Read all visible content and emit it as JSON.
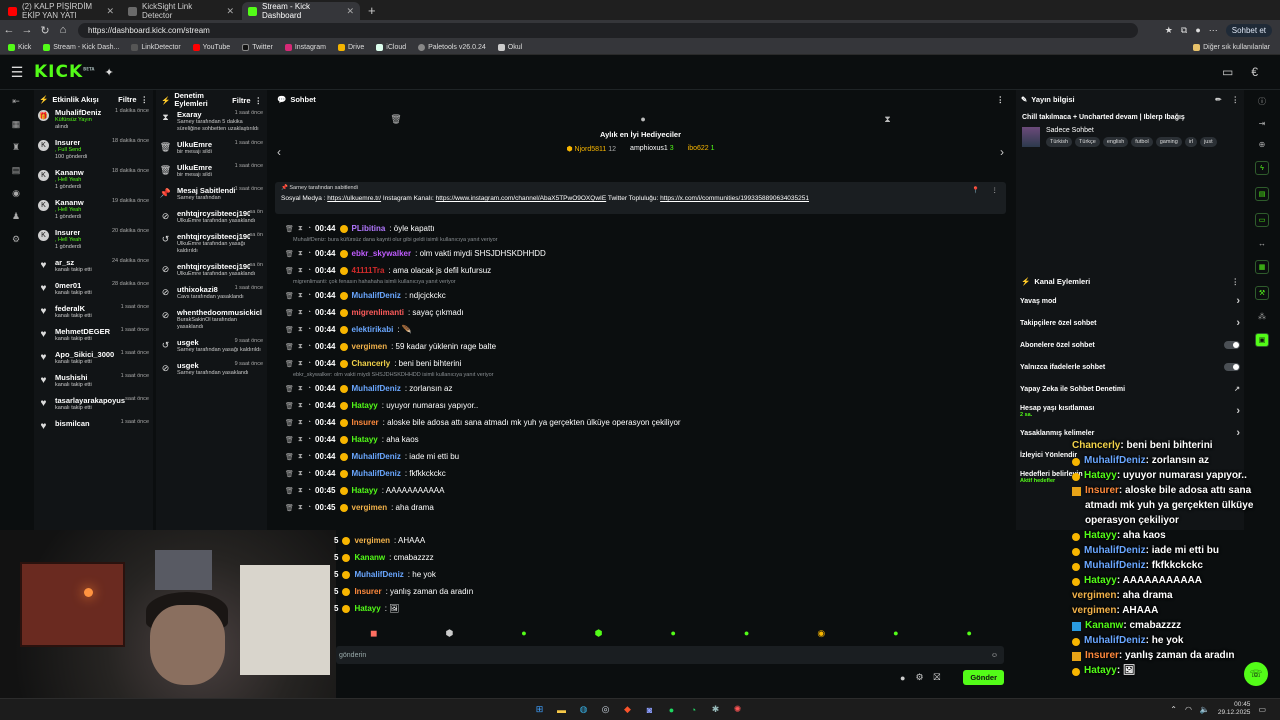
{
  "browser": {
    "tabs": [
      {
        "title": "(2) KALP PİŞİRDİM EKİP YAN YATI",
        "icon": "youtube-icon",
        "color": "#ff0000"
      },
      {
        "title": "KickSight Link Detector",
        "icon": "kicksight-icon",
        "color": "#4a4a4a"
      },
      {
        "title": "Stream - Kick Dashboard",
        "icon": "kick-icon",
        "color": "#53fc18"
      }
    ],
    "url": "https://dashboard.kick.com/stream",
    "profile_button": "Sohbet et",
    "bookmarks": [
      "Kick",
      "Stream - Kick Dash...",
      "LinkDetector",
      "YouTube",
      "Twitter",
      "Instagram",
      "Drive",
      "iCloud",
      "Paletools v26.0.24",
      "Okul"
    ],
    "other_bookmarks": "Diğer sık kullanılanlar"
  },
  "kick": {
    "logo": "KICK",
    "logo_sup": "BETA"
  },
  "activity": {
    "title": "Etkinlik Akışı",
    "filter": "Filtre",
    "items": [
      {
        "name": "MuhalifDeniz",
        "time": "1 dakika önce",
        "line1": "Küfürsüz Yayın",
        "line2": "alındı",
        "icon": "gift-icon"
      },
      {
        "name": "Insurer",
        "time": "18 dakika önce",
        "line1": ", Full Send",
        "line2": "100 gönderdi",
        "icon": "kick-icon"
      },
      {
        "name": "Kananw",
        "time": "18 dakika önce",
        "line1": ", Hell Yeah",
        "line2": "1 gönderdi",
        "icon": "kick-icon"
      },
      {
        "name": "Kananw",
        "time": "19 dakika önce",
        "line1": ", Hell Yeah",
        "line2": "1 gönderdi",
        "icon": "kick-icon"
      },
      {
        "name": "Insurer",
        "time": "20 dakika önce",
        "line1": ", Hell Yeah",
        "line2": "1 gönderdi",
        "icon": "kick-icon"
      },
      {
        "name": "ar_sz",
        "time": "24 dakika önce",
        "line1": "kanalı takip etti",
        "line2": "",
        "icon": "heart-icon"
      },
      {
        "name": "0mer01",
        "time": "28 dakika önce",
        "line1": "kanalı takip etti",
        "line2": "",
        "icon": "heart-icon"
      },
      {
        "name": "federalK",
        "time": "1 saat önce",
        "line1": "kanalı takip etti",
        "line2": "",
        "icon": "heart-icon"
      },
      {
        "name": "MehmetDEGER",
        "time": "1 saat önce",
        "line1": "kanalı takip etti",
        "line2": "",
        "icon": "heart-icon"
      },
      {
        "name": "Apo_Sikici_3000",
        "time": "1 saat önce",
        "line1": "kanalı takip etti",
        "line2": "",
        "icon": "heart-icon"
      },
      {
        "name": "Mushishi",
        "time": "1 saat önce",
        "line1": "kanalı takip etti",
        "line2": "",
        "icon": "heart-icon"
      },
      {
        "name": "tasarlayarakapoyusiken",
        "time": "saat önce",
        "line1": "kanalı takip etti",
        "line2": "",
        "icon": "heart-icon"
      },
      {
        "name": "bismilcan",
        "time": "1 saat önce",
        "line1": "",
        "line2": "",
        "icon": "heart-icon"
      }
    ]
  },
  "moderation": {
    "title": "Denetim Eylemleri",
    "filter": "Filtre",
    "items": [
      {
        "name": "Exaray",
        "time": "1 saat önce",
        "line1": "Sarney tarafından 5 dakika süreliğine sohbetten uzaklaştırıldı",
        "icon": "hourglass-icon"
      },
      {
        "name": "UlkuEmre",
        "time": "1 saat önce",
        "line1": "bir mesajı sildi",
        "icon": "trash-icon"
      },
      {
        "name": "UlkuEmre",
        "time": "1 saat önce",
        "line1": "bir mesajı sildi",
        "icon": "trash-icon"
      },
      {
        "name": "Mesaj Sabitlendi",
        "time": "1 saat önce",
        "line1": "Sarney tarafından",
        "icon": "pin-icon"
      },
      {
        "name": "enhtqjrcysibteecj1901",
        "time": "sa ön",
        "line1": "UlkuEmre tarafından yasaklandı",
        "icon": "ban-icon"
      },
      {
        "name": "enhtqjrcysibteecj1901",
        "time": "sa ön",
        "line1": "UlkuEmre tarafından yasağı kaldırıldı",
        "icon": "undo-icon"
      },
      {
        "name": "enhtqjrcysibteecj1901",
        "time": "sa ön",
        "line1": "UlkuEmre tarafından yasaklandı",
        "icon": "ban-icon"
      },
      {
        "name": "uthixokazi8",
        "time": "1 saat önce",
        "line1": "Cavs tarafından yasaklandı",
        "icon": "ban-icon"
      },
      {
        "name": "whenthedoommusickicl",
        "time": "",
        "line1": "BurakSakinOl tarafından yasaklandı",
        "icon": "ban-icon"
      },
      {
        "name": "usgek",
        "time": "9 saat önce",
        "line1": "Sarney tarafından yasağı kaldırıldı",
        "icon": "undo-icon"
      },
      {
        "name": "usgek",
        "time": "9 saat önce",
        "line1": "Sarney tarafından yasaklandı",
        "icon": "ban-icon"
      }
    ]
  },
  "chat": {
    "title": "Sohbet",
    "gifters_title": "Aylık en İyi Hediyeciler",
    "gifters": [
      {
        "name": "Njord5811",
        "count": "12"
      },
      {
        "name": "amphioxus1",
        "count": "3"
      },
      {
        "name": "ibo622",
        "count": "1"
      }
    ],
    "pinned_by": "Sarney tarafından sabitlendi",
    "pinned_text": "Sosyal Medya : ",
    "pinned_link1": "https://ulkuemre.tr/",
    "pinned_mid": " Instagram Kanalı: ",
    "pinned_link2": "https://www.instagram.com/channel/AbaX5TPwO9OXQwIE",
    "pinned_mid2": " Twitter Topluluğu: ",
    "pinned_link3": "https://x.com/i/communities/1993358890634035251",
    "messages": [
      {
        "reply": "",
        "time": "00:44",
        "name": "PLibitina",
        "color": "#b277ff",
        "text": ": öyle kapattı"
      },
      {
        "reply": "MuhalifDeniz: bura küfürsüz dana kaynti olur gibi geldi isimli kullanıcıya yanıt veriyor",
        "time": "00:44",
        "name": "ebkr_skywalker",
        "color": "#c05cff",
        "text": ": olm vakti miydi SHSJDHSKDHHDD"
      },
      {
        "reply": "",
        "time": "00:44",
        "name": "41111Tra",
        "color": "#d12b2b",
        "text": ": ama olacak js defil kufursuz"
      },
      {
        "reply": "migrenlimanti: çok fenasın hahahaha isimli kullanıcıya yanıt veriyor",
        "time": "00:44",
        "name": "MuhalifDeniz",
        "color": "#6aa7ff",
        "text": ": ndjcjckckc"
      },
      {
        "reply": "",
        "time": "00:44",
        "name": "migrenlimanti",
        "color": "#ff5c5c",
        "text": ": sayaç çıkmadı"
      },
      {
        "reply": "",
        "time": "00:44",
        "name": "elektirikabi",
        "color": "#6aa7ff",
        "text": ": 🪶"
      },
      {
        "reply": "",
        "time": "00:44",
        "name": "vergimen",
        "color": "#f2b24a",
        "text": ": 59 kadar yüklenin rage balte"
      },
      {
        "reply": "",
        "time": "00:44",
        "name": "Chancerly",
        "color": "#f2d24a",
        "text": ": beni beni bihterini"
      },
      {
        "reply": "ebkr_skywalker: olm vakti miydi SHSJDHSKDHHDD isimli kullanıcıya yanıt veriyor",
        "time": "00:44",
        "name": "MuhalifDeniz",
        "color": "#6aa7ff",
        "text": ": zorlansın az"
      },
      {
        "reply": "",
        "time": "00:44",
        "name": "Hatayy",
        "color": "#53fc18",
        "text": ": uyuyor numarası yapıyor.."
      },
      {
        "reply": "",
        "time": "00:44",
        "name": "Insurer",
        "color": "#ff8a3d",
        "text": ": aloske bile adosa attı sana atmadı mk yuh ya gerçekten ülküye operasyon çekiliyor"
      },
      {
        "reply": "",
        "time": "00:44",
        "name": "Hatayy",
        "color": "#53fc18",
        "text": ": aha kaos"
      },
      {
        "reply": "",
        "time": "00:44",
        "name": "MuhalifDeniz",
        "color": "#6aa7ff",
        "text": ": iade mi etti bu"
      },
      {
        "reply": "",
        "time": "00:44",
        "name": "MuhalifDeniz",
        "color": "#6aa7ff",
        "text": ": fkfkkckckc"
      },
      {
        "reply": "",
        "time": "00:45",
        "name": "Hatayy",
        "color": "#53fc18",
        "text": ": AAAAAAAAAAA"
      },
      {
        "reply": "",
        "time": "00:45",
        "name": "vergimen",
        "color": "#f2b24a",
        "text": ": aha drama"
      }
    ],
    "low_messages": [
      {
        "time": "5",
        "name": "vergimen",
        "color": "#f2b24a",
        "text": ": AHAAA"
      },
      {
        "time": "5",
        "name": "Kananw",
        "color": "#53fc18",
        "text": ": cmabazzzz"
      },
      {
        "time": "5",
        "name": "MuhalifDeniz",
        "color": "#6aa7ff",
        "text": ": he yok"
      },
      {
        "time": "5",
        "name": "Insurer",
        "color": "#ff8a3d",
        "text": ": yanlış zaman da aradın"
      },
      {
        "time": "5",
        "name": "Hatayy",
        "color": "#53fc18",
        "text": ": 🖼"
      }
    ],
    "input_placeholder": "gönderin",
    "send": "Gönder"
  },
  "stream_info": {
    "title": "Yayın bilgisi",
    "stream_title": "Chill takılmaca + Uncharted devam | Iblerp Ibağış",
    "category": "Sadece Sohbet",
    "tags": [
      "Türkish",
      "Türkçe",
      "english",
      "futbol",
      "gaming",
      "irl",
      "just"
    ]
  },
  "channel_actions": {
    "title": "Kanal Eylemleri",
    "items": [
      {
        "label": "Yavaş mod",
        "type": "arrow"
      },
      {
        "label": "Takipçilere özel sohbet",
        "type": "arrow"
      },
      {
        "label": "Abonelere özel sohbet",
        "type": "toggle"
      },
      {
        "label": "Yalnızca ifadelerle sohbet",
        "type": "toggle"
      },
      {
        "label": "Yapay Zeka ile Sohbet Denetimi",
        "type": "ext"
      },
      {
        "label": "Hesap yaşı kısıtlaması",
        "type": "arrow",
        "sub": "2 sa."
      },
      {
        "label": "Yasaklanmış kelimeler",
        "type": "arrow"
      },
      {
        "label": "İzleyici Yönlendir",
        "type": ""
      },
      {
        "label": "Hedefleri belirleyin",
        "type": "arrow",
        "sub": "Aktif hedefler"
      }
    ]
  },
  "overlay": [
    {
      "name": "Chancerly",
      "color": "#f2d24a",
      "text": ": beni beni bihterini",
      "badge": ""
    },
    {
      "name": "MuhalifDeniz",
      "color": "#6aa7ff",
      "text": ": zorlansın az",
      "badge": "b"
    },
    {
      "name": "Hatayy",
      "color": "#53fc18",
      "text": ": uyuyor numarası yapıyor..",
      "badge": "b"
    },
    {
      "name": "Insurer",
      "color": "#ff8a3d",
      "text": ": aloske bile adosa attı sana atmadı mk yuh ya gerçekten ülküye operasyon çekiliyor",
      "badge": "m"
    },
    {
      "name": "Hatayy",
      "color": "#53fc18",
      "text": ": aha kaos",
      "badge": "b"
    },
    {
      "name": "MuhalifDeniz",
      "color": "#6aa7ff",
      "text": ": iade mi etti bu",
      "badge": "b"
    },
    {
      "name": "MuhalifDeniz",
      "color": "#6aa7ff",
      "text": ": fkfkkckckc",
      "badge": "b"
    },
    {
      "name": "Hatayy",
      "color": "#53fc18",
      "text": ": AAAAAAAAAAA",
      "badge": "b"
    },
    {
      "name": "vergimen",
      "color": "#f2b24a",
      "text": ": aha drama",
      "badge": ""
    },
    {
      "name": "vergimen",
      "color": "#f2b24a",
      "text": ": AHAAA",
      "badge": ""
    },
    {
      "name": "Kananw",
      "color": "#53fc18",
      "text": ": cmabazzzz",
      "badge": "d"
    },
    {
      "name": "MuhalifDeniz",
      "color": "#6aa7ff",
      "text": ": he yok",
      "badge": "b"
    },
    {
      "name": "Insurer",
      "color": "#ff8a3d",
      "text": ": yanlış zaman da aradın",
      "badge": "m"
    },
    {
      "name": "Hatayy",
      "color": "#53fc18",
      "text": ": 🖼",
      "badge": "b"
    }
  ],
  "taskbar": {
    "time": "00:45",
    "date": "29.12.2025"
  },
  "colors": {
    "accent": "#53fc18",
    "bg": "#0b0e0f",
    "panel": "#111416"
  }
}
